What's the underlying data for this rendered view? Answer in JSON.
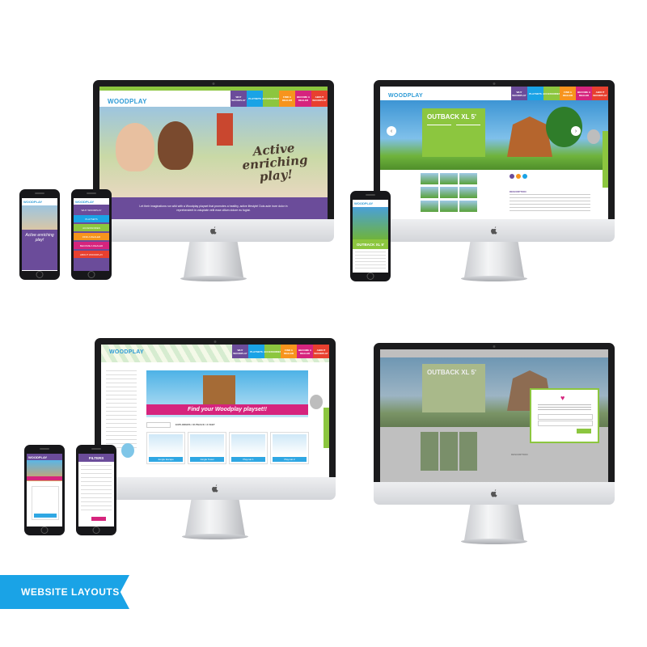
{
  "caption": "WEBSITE LAYOUTS",
  "brand": {
    "logo": "WOODPLAY",
    "colors": {
      "purple": "#6b4c9a",
      "green": "#8cc63f",
      "teal": "#1aa3e6",
      "orange": "#f7941d",
      "red": "#e8402f",
      "magenta": "#d6247d",
      "blue": "#2e9bd6"
    }
  },
  "nav": [
    {
      "label": "WHY WOODPLAY",
      "color": "#6b4c9a"
    },
    {
      "label": "PLAYSETS",
      "color": "#1aa3e6"
    },
    {
      "label": "ACCESSORIES",
      "color": "#8cc63f"
    },
    {
      "label": "FIND A DEALER",
      "color": "#f7941d"
    },
    {
      "label": "BECOME A DEALER",
      "color": "#d6247d"
    },
    {
      "label": "ABOUT WOODPLAY",
      "color": "#e8402f"
    }
  ],
  "home": {
    "hero_text": "Active enriching play!",
    "banner_text": "Let their imaginations run wild with a Woodplay playset that promotes a healthy, active lifestyle! Duis aute irure dolor in reprehenderit in voluptate velit esse cillum dolore eu fugiat."
  },
  "product": {
    "title": "OUTBACK XL 5'",
    "description_heading": "DESCRIPTION"
  },
  "listing": {
    "banner_text": "Find your Woodplay playset!!",
    "breadcrumb": "EXPLORERS / OUTBACK / 3 FEET",
    "cards": [
      "Jungle Escape",
      "Jungle Tower",
      "Playmat 1",
      "Playmat 2"
    ]
  },
  "mobile": {
    "menu": [
      "WHY WOODPLAY",
      "PLAYSETS",
      "ACCESSORIES",
      "FIND A DEALER",
      "BECOME A DEALER",
      "ABOUT WOODPLAY"
    ],
    "product_title": "OUTBACK XL 5'",
    "filters_label": "FILTERS"
  }
}
